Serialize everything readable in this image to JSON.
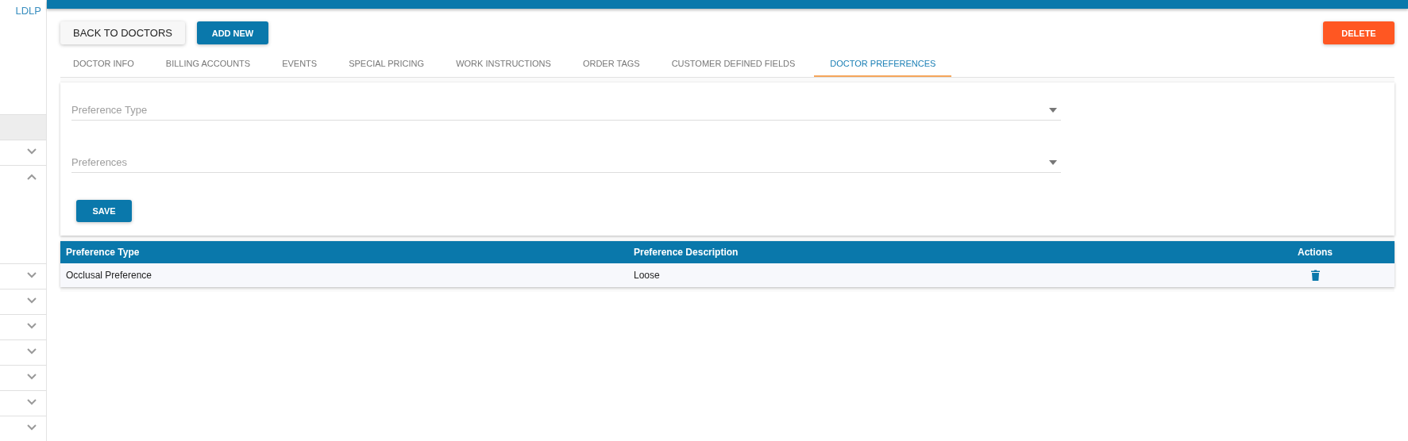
{
  "sidebar": {
    "logo_text": "LDLP",
    "items": [
      {
        "kind": "plain",
        "selected": true
      },
      {
        "kind": "group",
        "expanded": false,
        "selected": false
      },
      {
        "kind": "group",
        "expanded": true,
        "selected": false
      },
      {
        "kind": "group",
        "expanded": false,
        "selected": false
      },
      {
        "kind": "group",
        "expanded": false,
        "selected": false
      },
      {
        "kind": "group",
        "expanded": false,
        "selected": false
      },
      {
        "kind": "group",
        "expanded": false,
        "selected": false
      },
      {
        "kind": "group",
        "expanded": false,
        "selected": false
      },
      {
        "kind": "group",
        "expanded": false,
        "selected": false
      },
      {
        "kind": "group",
        "expanded": false,
        "selected": false
      }
    ]
  },
  "toolbar": {
    "back_button": "BACK TO DOCTORS",
    "add_button": "ADD NEW",
    "delete_button": "DELETE"
  },
  "tabs": [
    {
      "label": "DOCTOR INFO",
      "selected": false
    },
    {
      "label": "BILLING ACCOUNTS",
      "selected": false
    },
    {
      "label": "EVENTS",
      "selected": false
    },
    {
      "label": "SPECIAL PRICING",
      "selected": false
    },
    {
      "label": "WORK INSTRUCTIONS",
      "selected": false
    },
    {
      "label": "ORDER TAGS",
      "selected": false
    },
    {
      "label": "CUSTOMER DEFINED FIELDS",
      "selected": false
    },
    {
      "label": "DOCTOR PREFERENCES",
      "selected": true
    }
  ],
  "form": {
    "fields": [
      {
        "placeholder": "Preference Type"
      },
      {
        "placeholder": "Preferences"
      }
    ],
    "save_button": "SAVE"
  },
  "table": {
    "columns": [
      "Preference Type",
      "Preference Description",
      "Actions"
    ],
    "rows": [
      {
        "cells": [
          "Occlusal Preference",
          "Loose"
        ]
      }
    ]
  }
}
